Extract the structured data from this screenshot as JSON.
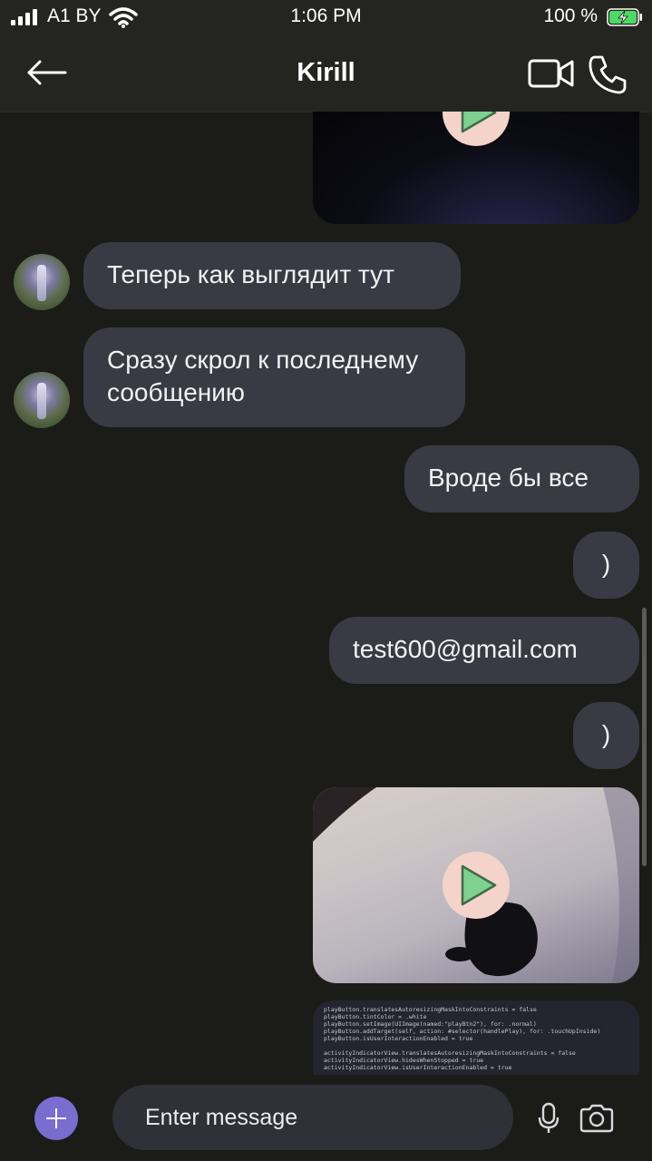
{
  "status_bar": {
    "carrier": "A1 BY",
    "time": "1:06 PM",
    "battery_percent": "100 %",
    "battery_level": 1.0,
    "signal_bars": 4
  },
  "header": {
    "title": "Kirill",
    "back_icon": "arrow-left-icon",
    "video_icon": "video-camera-icon",
    "call_icon": "phone-icon"
  },
  "messages": [
    {
      "type": "video",
      "from": "me",
      "play_icon": "play-icon"
    },
    {
      "type": "text",
      "from": "contact",
      "text": "Теперь как выглядит тут"
    },
    {
      "type": "text",
      "from": "contact",
      "text": "Сразу скрол к последнему сообщению"
    },
    {
      "type": "text",
      "from": "me",
      "text": "Вроде бы все"
    },
    {
      "type": "text",
      "from": "me",
      "text": ")"
    },
    {
      "type": "text",
      "from": "me",
      "text": "test600@gmail.com"
    },
    {
      "type": "text",
      "from": "me",
      "text": ")"
    },
    {
      "type": "video",
      "from": "me",
      "play_icon": "play-icon"
    },
    {
      "type": "image",
      "from": "me"
    }
  ],
  "code_lines": [
    "playButton.translatesAutoresizingMaskIntoConstraints = false",
    "playButton.tintColor = .white",
    "playButton.setImage(UIImage(named:\"playBtn2\"), for: .normal)",
    "playButton.addTarget(self, action: #selector(handlePlay), for: .touchUpInside)",
    "playButton.isUserInteractionEnabled = true",
    "",
    "activityIndicatorView.translatesAutoresizingMaskIntoConstraints = false",
    "activityIndicatorView.hidesWhenStopped = true",
    "activityIndicatorView.isUserInteractionEnabled = true"
  ],
  "composer": {
    "placeholder": "Enter message",
    "add_icon": "plus-icon",
    "mic_icon": "microphone-icon",
    "camera_icon": "camera-icon"
  },
  "colors": {
    "background": "#1b1c18",
    "bubble": "#3a3a44",
    "accent": "#7b6ccf",
    "play_button": "#f4d3cb",
    "play_icon": "#7fd18f"
  }
}
